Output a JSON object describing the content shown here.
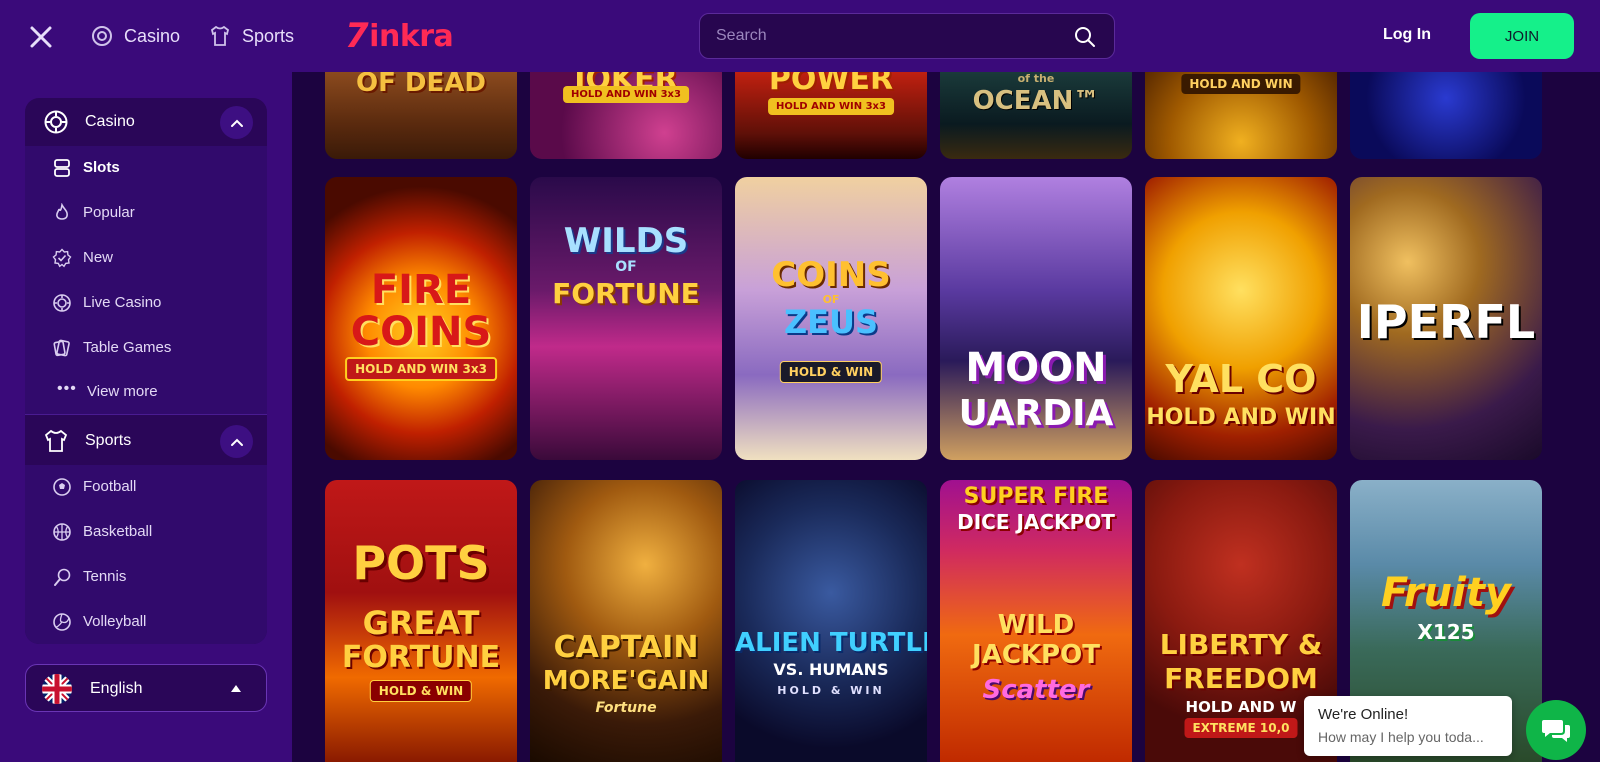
{
  "header": {
    "casino_label": "Casino",
    "sports_label": "Sports",
    "logo_text": "inkra",
    "logo_mark": "7",
    "search_placeholder": "Search",
    "login_label": "Log In",
    "join_label": "JOIN"
  },
  "sidebar": {
    "casino": {
      "label": "Casino",
      "items": [
        {
          "label": "Slots",
          "icon": "slots-icon"
        },
        {
          "label": "Popular",
          "icon": "flame-icon"
        },
        {
          "label": "New",
          "icon": "new-badge-icon"
        },
        {
          "label": "Live Casino",
          "icon": "chip-icon"
        },
        {
          "label": "Table Games",
          "icon": "cards-icon"
        }
      ],
      "view_more": "View more"
    },
    "sports": {
      "label": "Sports",
      "items": [
        {
          "label": "Football",
          "icon": "football-icon"
        },
        {
          "label": "Basketball",
          "icon": "basketball-icon"
        },
        {
          "label": "Tennis",
          "icon": "tennis-icon"
        },
        {
          "label": "Volleyball",
          "icon": "volleyball-icon"
        }
      ]
    },
    "language": "English"
  },
  "games": {
    "row1": [
      {
        "t1": "OF DEAD"
      },
      {
        "t1": "JOKER",
        "badge": "HOLD AND WIN 3x3"
      },
      {
        "t1": "POWER",
        "badge": "HOLD AND WIN 3x3"
      },
      {
        "t1": "of the",
        "t2": "OCEAN™"
      },
      {
        "badge": "HOLD AND WIN"
      },
      {}
    ],
    "row2": [
      {
        "t1": "FIRE",
        "t2": "COINS",
        "badge": "HOLD AND WIN 3x3"
      },
      {
        "t1": "WILDS",
        "t2": "OF",
        "t3": "FORTUNE"
      },
      {
        "t1": "COINS",
        "t2": "OF",
        "t3": "ZEUS",
        "badge": "HOLD & WIN"
      },
      {
        "t1": "MOON",
        "t2": "UARDIA"
      },
      {
        "t1": "YAL CO",
        "t2": "HOLD AND WIN"
      },
      {
        "t1": "IPERFL"
      }
    ],
    "row3": [
      {
        "t1": "POTS",
        "t2": "GREAT",
        "t3": "FORTUNE",
        "badge": "HOLD & WIN"
      },
      {
        "t1": "CAPTAIN",
        "t2": "MORE'GAIN",
        "t3": "Fortune"
      },
      {
        "t1": "ALIEN TURTLES",
        "t2": "VS. HUMANS",
        "t3": "HOLD & WIN"
      },
      {
        "t1": "SUPER FIRE",
        "t2": "DICE JACKPOT",
        "t3": "WILD JACKPOT",
        "badge": "Scatter"
      },
      {
        "t1": "LIBERTY &",
        "t2": "FREEDOM",
        "t3": "HOLD AND W",
        "badge": "EXTREME 10,0"
      },
      {
        "t1": "Fruity",
        "t2": "X125"
      }
    ]
  },
  "chat": {
    "title": "We're Online!",
    "subtitle": "How may I help you toda..."
  },
  "colors": {
    "topbar": "#3a0a7a",
    "accent_join": "#15f08a",
    "brand": "#ff2a55"
  }
}
